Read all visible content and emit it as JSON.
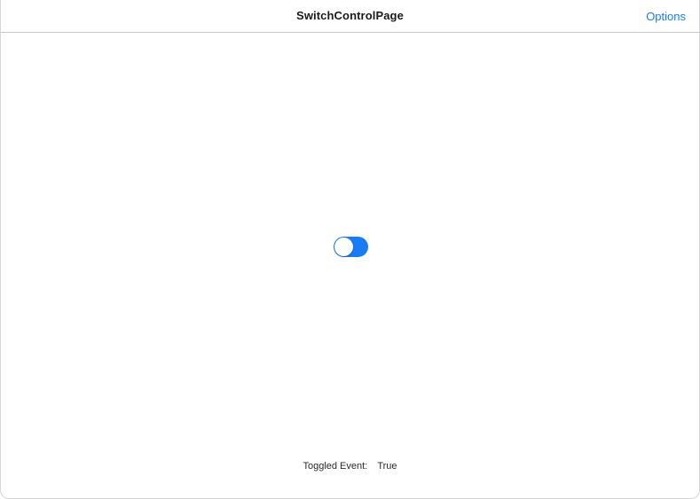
{
  "navbar": {
    "title": "SwitchControlPage",
    "options_label": "Options"
  },
  "switch": {
    "state": "on",
    "on_color": "#1a7cf4"
  },
  "status": {
    "label": "Toggled Event:",
    "value": "True"
  },
  "colors": {
    "accent": "#1a7cf4",
    "divider": "#c8c8c8",
    "background": "#ffffff"
  }
}
